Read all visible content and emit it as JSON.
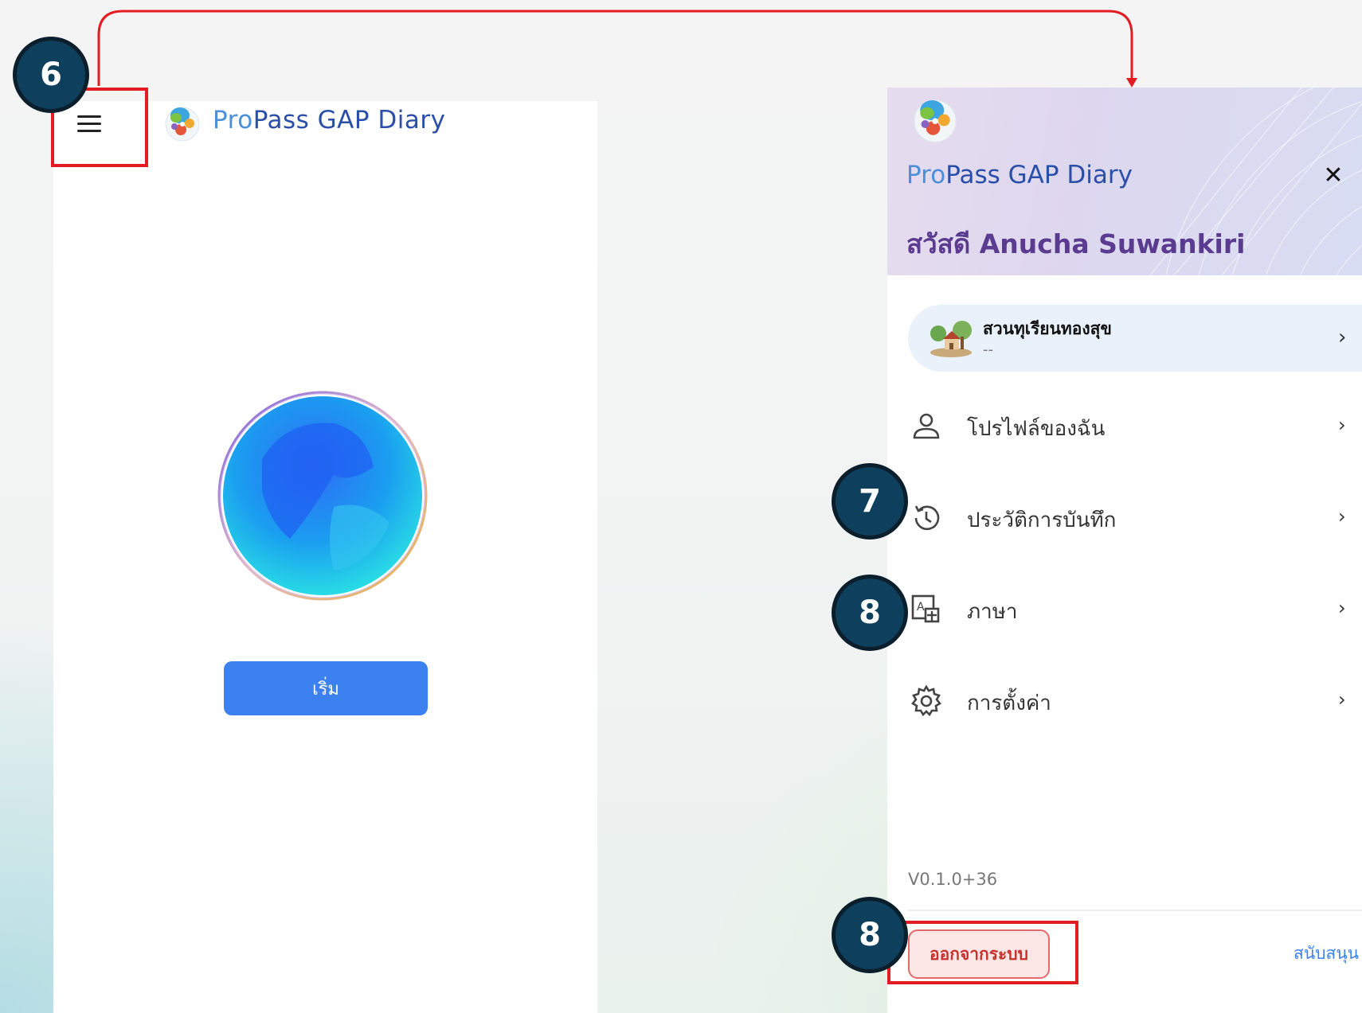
{
  "steps": {
    "menu_step": "6",
    "history_step": "7",
    "language_step": "8",
    "logout_step": "8"
  },
  "left_screen": {
    "brand_pro": "Pro",
    "brand_rest": "Pass GAP Diary",
    "start_button": "เริ่ม"
  },
  "drawer": {
    "brand_pro": "Pro",
    "brand_rest": "Pass GAP Diary",
    "close_symbol": "✕",
    "greeting": "สวัสดี Anucha Suwankiri",
    "farm": {
      "name": "สวนทุเรียนทองสุข",
      "subtitle": "--"
    },
    "menu": [
      {
        "label": "โปรไฟล์ของฉัน",
        "icon": "person-icon"
      },
      {
        "label": "ประวัติการบันทึก",
        "icon": "history-icon"
      },
      {
        "label": "ภาษา",
        "icon": "translate-icon"
      },
      {
        "label": "การตั้งค่า",
        "icon": "gear-icon"
      }
    ],
    "chevron": "›",
    "version": "V0.1.0+36",
    "logout": "ออกจากระบบ",
    "support": "สนับสนุน"
  },
  "colors": {
    "accent_blue": "#3b82f0",
    "badge": "#0e3f5c",
    "highlight_red": "#e31b23",
    "greeting_purple": "#5a3b8f",
    "logout_red": "#c9302c"
  }
}
